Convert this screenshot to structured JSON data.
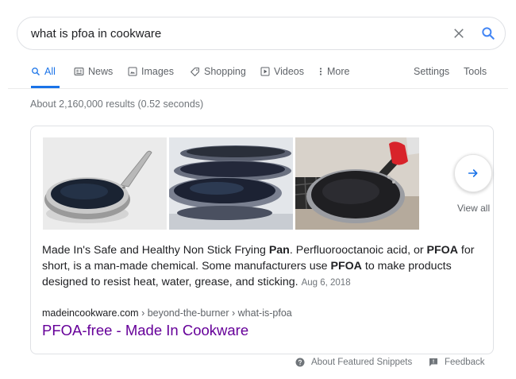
{
  "search": {
    "query": "what is pfoa in cookware"
  },
  "tabs": [
    {
      "label": "All",
      "icon": "search-icon",
      "active": true
    },
    {
      "label": "News",
      "icon": "news-icon"
    },
    {
      "label": "Images",
      "icon": "image-icon"
    },
    {
      "label": "Shopping",
      "icon": "tag-icon"
    },
    {
      "label": "Videos",
      "icon": "play-icon"
    },
    {
      "label": "More",
      "icon": "more-vertical-icon"
    },
    {
      "label": "Settings"
    },
    {
      "label": "Tools"
    }
  ],
  "result_stats": "About 2,160,000 results (0.52 seconds)",
  "featured_snippet": {
    "view_all": "View all",
    "text": {
      "p1": "Made In's Safe and Healthy Non Stick Frying ",
      "b1": "Pan",
      "p2": ". Perfluorooctanoic acid, or ",
      "b2": "PFOA",
      "p3": " for short, is a man-made chemical. Some manufacturers use ",
      "b3": "PFOA",
      "p4": " to make products designed to resist heat, water, grease, and sticking.",
      "date": "Aug 6, 2018"
    },
    "cite_domain": "madeincookware.com",
    "cite_path": " › beyond-the-burner › what-is-pfoa",
    "link_title": "PFOA-free - Made In Cookware"
  },
  "footer": {
    "about": "About Featured Snippets",
    "feedback": "Feedback"
  },
  "colors": {
    "accent": "#1a73e8",
    "visited_link": "#660099",
    "muted": "#70757a"
  }
}
